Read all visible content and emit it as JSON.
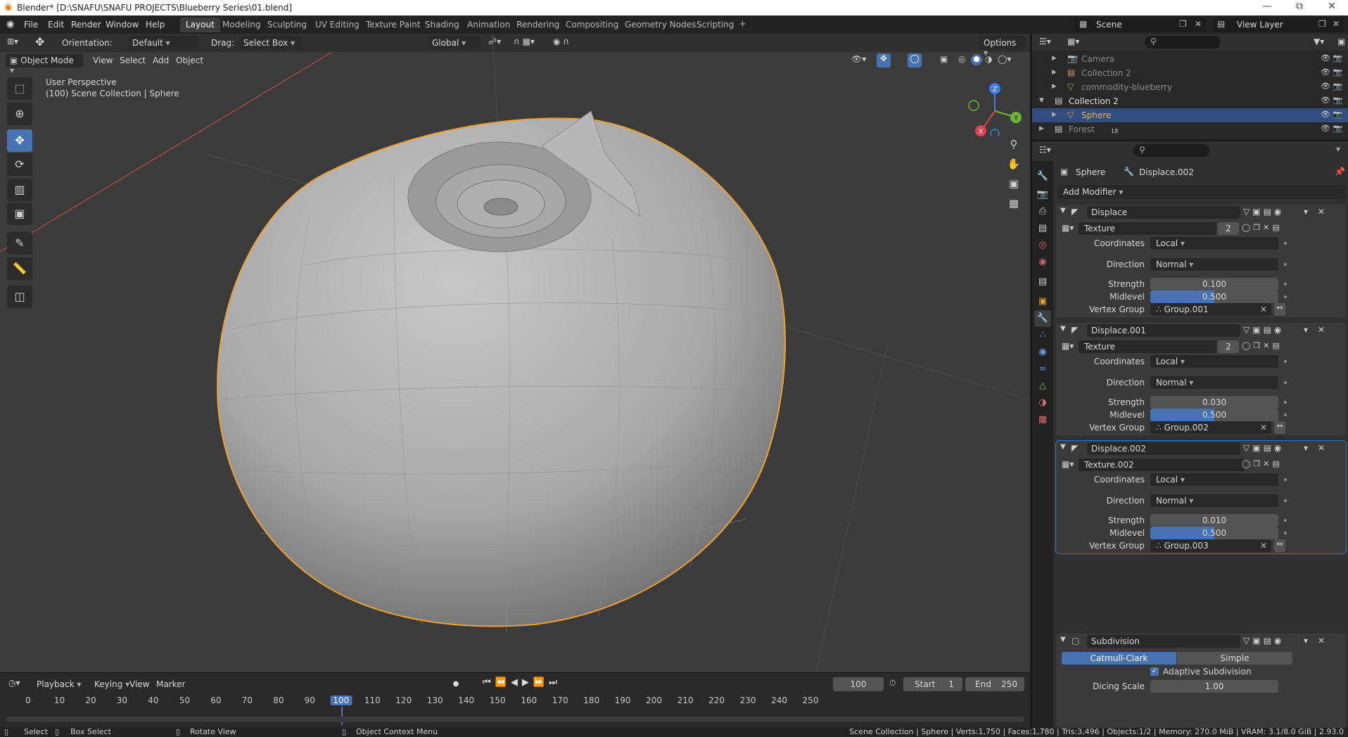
{
  "window": {
    "title": "Blender* [D:\\SNAFU\\SNAFU PROJECTS\\Blueberry Series\\01.blend]",
    "controls": [
      "—",
      "⧉",
      "✕"
    ]
  },
  "menu": [
    "File",
    "Edit",
    "Render",
    "Window",
    "Help"
  ],
  "workspaces": [
    "Layout",
    "Modeling",
    "Sculpting",
    "UV Editing",
    "Texture Paint",
    "Shading",
    "Animation",
    "Rendering",
    "Compositing",
    "Geometry Nodes",
    "Scripting"
  ],
  "scene": {
    "name": "Scene",
    "view_layer": "View Layer"
  },
  "tool_header": {
    "orientation_label": "Orientation:",
    "orientation_value": "Default",
    "drag_label": "Drag:",
    "drag_value": "Select Box",
    "transform_orientation": "Global",
    "options": "Options"
  },
  "viewport_header": {
    "mode": "Object Mode",
    "menus": [
      "View",
      "Select",
      "Add",
      "Object"
    ]
  },
  "viewport": {
    "perspective": "User Perspective",
    "collection_info": "(100) Scene Collection | Sphere",
    "gizmo_axes": [
      "Z",
      "Y",
      "X"
    ]
  },
  "outliner": {
    "rows": [
      {
        "label": "Camera",
        "dim": true
      },
      {
        "label": "Collection 2",
        "dim": true
      },
      {
        "label": "commodity-blueberry",
        "dim": true
      },
      {
        "label": "Collection 2",
        "dim": false
      },
      {
        "label": "Sphere",
        "dim": false,
        "selected": true
      },
      {
        "label": "Forest",
        "dim": true,
        "badge": "18"
      }
    ]
  },
  "properties": {
    "breadcrumb_object": "Sphere",
    "breadcrumb_modifier": "Displace.002",
    "add_modifier": "Add Modifier",
    "modifiers": [
      {
        "name": "Displace",
        "texture": "Texture",
        "users": "2",
        "coordinates": "Local",
        "direction": "Normal",
        "strength": "0.100",
        "midlevel": "0.500",
        "midlevel_fraction": 0.5,
        "vertex_group": "Group.001"
      },
      {
        "name": "Displace.001",
        "texture": "Texture",
        "users": "2",
        "coordinates": "Local",
        "direction": "Normal",
        "strength": "0.030",
        "midlevel": "0.500",
        "midlevel_fraction": 0.5,
        "vertex_group": "Group.002"
      },
      {
        "name": "Displace.002",
        "texture": "Texture.002",
        "users": "",
        "coordinates": "Local",
        "direction": "Normal",
        "strength": "0.010",
        "midlevel": "0.500",
        "midlevel_fraction": 0.5,
        "vertex_group": "Group.003"
      }
    ],
    "labels": {
      "coordinates": "Coordinates",
      "direction": "Direction",
      "strength": "Strength",
      "midlevel": "Midlevel",
      "vertex_group": "Vertex Group"
    },
    "subdivision": {
      "name": "Subdivision",
      "mode_a": "Catmull-Clark",
      "mode_b": "Simple",
      "adaptive": "Adaptive Subdivision",
      "dicing_label": "Dicing Scale",
      "dicing_value": "1.00"
    }
  },
  "timeline": {
    "menus": [
      "Playback",
      "Keying",
      "View",
      "Marker"
    ],
    "current_frame": "100",
    "start_label": "Start",
    "start_value": "1",
    "end_label": "End",
    "end_value": "250",
    "ruler": [
      "0",
      "10",
      "20",
      "30",
      "40",
      "50",
      "60",
      "70",
      "80",
      "90",
      "100",
      "110",
      "120",
      "130",
      "140",
      "150",
      "160",
      "170",
      "180",
      "190",
      "200",
      "210",
      "220",
      "230",
      "240",
      "250"
    ]
  },
  "statusbar": {
    "select": "Select",
    "box_select": "Box Select",
    "rotate_view": "Rotate View",
    "context_menu": "Object Context Menu",
    "stats": "Scene Collection | Sphere | Verts:1,750 | Faces:1,780 | Tris:3,496 | Objects:1/2 | Memory: 270.0 MiB | VRAM: 3.1/8.0 GiB | 2.93.0"
  },
  "colors": {
    "accent": "#4772b3",
    "selection_outline": "#f0a030",
    "viewport_bg": "#3b3b3b"
  }
}
